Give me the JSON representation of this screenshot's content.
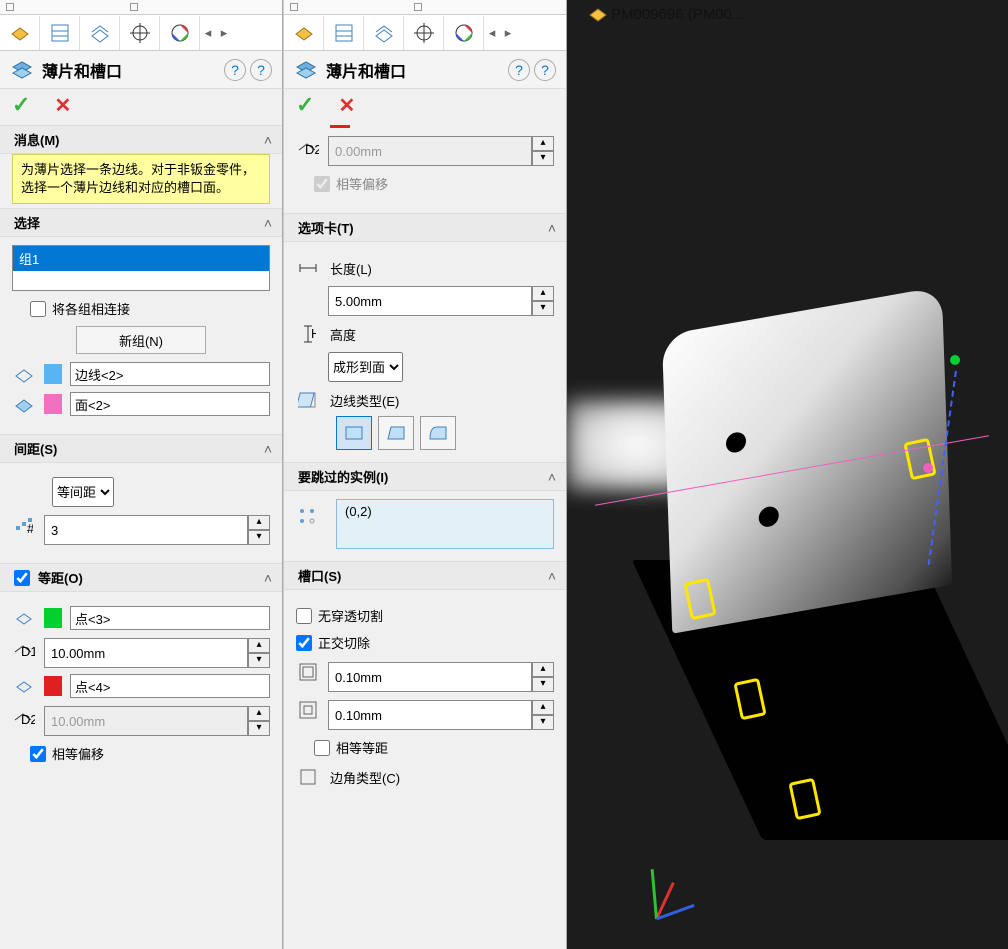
{
  "viewport": {
    "title": "PM009696 (PM00..."
  },
  "panel_title": "薄片和槽口",
  "left": {
    "message_header": "消息(M)",
    "message_text": "为薄片选择一条边线。对于非钣金零件，选择一个薄片边线和对应的槽口面。",
    "selection_header": "选择",
    "group_item": "组1",
    "connect_groups": "将各组相连接",
    "new_group_button": "新组(N)",
    "edge_value": "边线<2>",
    "face_value": "面<2>",
    "spacing_header": "间距(S)",
    "spacing_mode": "等间距",
    "count_value": "3",
    "equal_header": "等距(O)",
    "point3_value": "点<3>",
    "distance_d1": "10.00mm",
    "point4_value": "点<4>",
    "distance_d2": "10.00mm",
    "equal_offset": "相等偏移"
  },
  "right": {
    "distance_d2": "0.00mm",
    "equal_offset": "相等偏移",
    "tab_header": "选项卡(T)",
    "length_label": "长度(L)",
    "length_value": "5.00mm",
    "height_label": "高度",
    "height_mode": "成形到面",
    "edge_type_label": "边线类型(E)",
    "skip_header": "要跳过的实例(I)",
    "skip_value": "(0,2)",
    "slot_header": "槽口(S)",
    "no_through": "无穿透切割",
    "ortho_cut": "正交切除",
    "offset1": "0.10mm",
    "offset2": "0.10mm",
    "equal_equal": "相等等距",
    "corner_label": "边角类型(C)"
  }
}
